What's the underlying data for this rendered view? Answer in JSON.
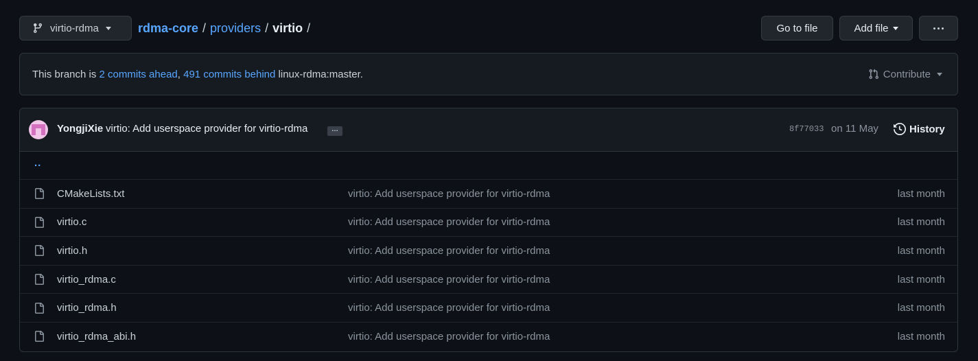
{
  "branch": {
    "name": "virtio-rdma",
    "icon": "git-branch-icon"
  },
  "breadcrumb": {
    "repo": "rdma-core",
    "sep1": "/",
    "folder": "providers",
    "sep2": "/",
    "current": "virtio",
    "sep3": "/"
  },
  "toolbar": {
    "goto_label": "Go to file",
    "addfile_label": "Add file",
    "more_icon": "kebab-horizontal-icon"
  },
  "branch_status": {
    "prefix": "This branch is ",
    "ahead": "2 commits ahead",
    "comma": ", ",
    "behind": "491 commits behind",
    "suffix": " linux-rdma:master.",
    "contribute_label": "Contribute",
    "contribute_icon": "git-pull-request-icon"
  },
  "latest_commit": {
    "author": "YongjiXie",
    "message": "virtio: Add userspace provider for virtio-rdma",
    "ellipsis": "…",
    "sha": "8f77033",
    "date": "on 11 May",
    "history_label": "History",
    "history_icon": "history-icon"
  },
  "files": [
    {
      "name": "..",
      "type": "up"
    },
    {
      "name": "CMakeLists.txt",
      "message": "virtio: Add userspace provider for virtio-rdma",
      "age": "last month",
      "icon": "file-icon"
    },
    {
      "name": "virtio.c",
      "message": "virtio: Add userspace provider for virtio-rdma",
      "age": "last month",
      "icon": "file-icon"
    },
    {
      "name": "virtio.h",
      "message": "virtio: Add userspace provider for virtio-rdma",
      "age": "last month",
      "icon": "file-icon"
    },
    {
      "name": "virtio_rdma.c",
      "message": "virtio: Add userspace provider for virtio-rdma",
      "age": "last month",
      "icon": "file-icon"
    },
    {
      "name": "virtio_rdma.h",
      "message": "virtio: Add userspace provider for virtio-rdma",
      "age": "last month",
      "icon": "file-icon"
    },
    {
      "name": "virtio_rdma_abi.h",
      "message": "virtio: Add userspace provider for virtio-rdma",
      "age": "last month",
      "icon": "file-icon"
    }
  ],
  "colors": {
    "background": "#0d1117",
    "panel": "#161b22",
    "border": "#30363d",
    "link": "#58a6ff",
    "text": "#c9d1d9",
    "muted": "#8b949e"
  }
}
